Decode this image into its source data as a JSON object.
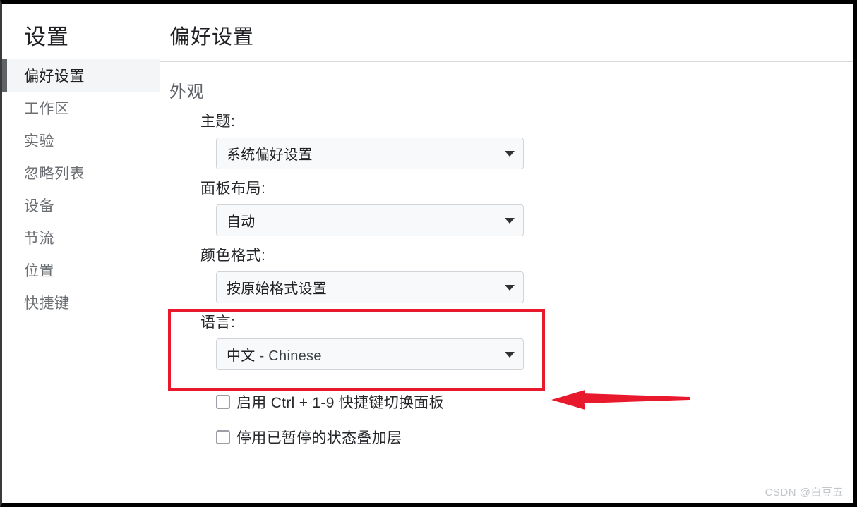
{
  "sidebar": {
    "title": "设置",
    "items": [
      {
        "label": "偏好设置",
        "selected": true
      },
      {
        "label": "工作区",
        "selected": false
      },
      {
        "label": "实验",
        "selected": false
      },
      {
        "label": "忽略列表",
        "selected": false
      },
      {
        "label": "设备",
        "selected": false
      },
      {
        "label": "节流",
        "selected": false
      },
      {
        "label": "位置",
        "selected": false
      },
      {
        "label": "快捷键",
        "selected": false
      }
    ]
  },
  "main": {
    "page_title": "偏好设置",
    "section_title": "外观",
    "fields": [
      {
        "label": "主题:",
        "value": "系统偏好设置",
        "icon": "chevron-down-icon"
      },
      {
        "label": "面板布局:",
        "value": "自动",
        "icon": "chevron-down-icon"
      },
      {
        "label": "颜色格式:",
        "value": "按原始格式设置",
        "icon": "chevron-down-icon"
      }
    ],
    "language_field": {
      "label": "语言:",
      "value_cjk": "中文",
      "value_latin": " - Chinese",
      "icon": "chevron-down-icon",
      "highlight_color": "#e8192c"
    },
    "checkboxes": [
      {
        "label": "启用 Ctrl + 1-9 快捷键切换面板",
        "checked": false
      },
      {
        "label": "停用已暂停的状态叠加层",
        "checked": false
      }
    ]
  },
  "annotation": {
    "arrow_color": "#e8192c",
    "arrow_direction": "left"
  },
  "watermark": {
    "text": "CSDN @白豆五"
  }
}
